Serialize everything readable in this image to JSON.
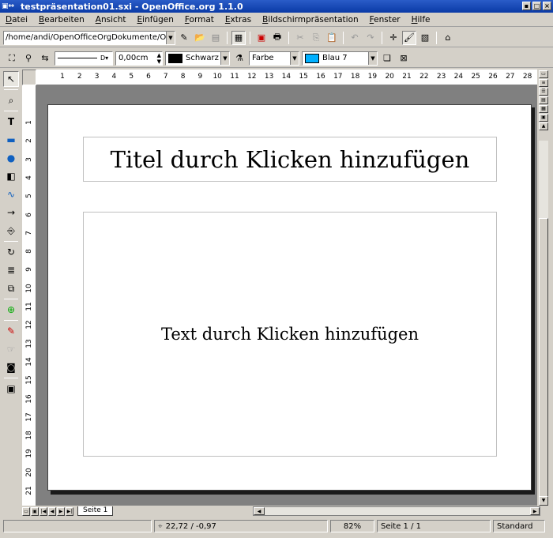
{
  "window": {
    "title": "testpräsentation01.sxi - OpenOffice.org 1.1.0"
  },
  "menu": [
    "Datei",
    "Bearbeiten",
    "Ansicht",
    "Einfügen",
    "Format",
    "Extras",
    "Bildschirmpräsentation",
    "Fenster",
    "Hilfe"
  ],
  "toolbar1": {
    "url": "/home/andi/OpenOfficeOrgDokumente/Opera"
  },
  "toolbar2": {
    "line_width": "0,00cm",
    "line_color": "Schwarz",
    "line_color_hex": "#000000",
    "area_style": "Farbe",
    "area_color": "Blau 7",
    "area_color_hex": "#00b0ff"
  },
  "hruler_ticks": [
    "1",
    "2",
    "3",
    "4",
    "5",
    "6",
    "7",
    "8",
    "9",
    "10",
    "11",
    "12",
    "13",
    "14",
    "15",
    "16",
    "17",
    "18",
    "19",
    "20",
    "21",
    "22",
    "23",
    "24",
    "25",
    "26",
    "27",
    "28"
  ],
  "vruler_ticks": [
    "1",
    "2",
    "3",
    "4",
    "5",
    "6",
    "7",
    "8",
    "9",
    "10",
    "11",
    "12",
    "13",
    "14",
    "15",
    "16",
    "17",
    "18",
    "19",
    "20",
    "21"
  ],
  "slide": {
    "title_placeholder": "Titel durch Klicken hinzufügen",
    "text_placeholder": "Text durch Klicken hinzufügen"
  },
  "tabs": {
    "slide_tab": "Seite 1"
  },
  "status": {
    "position": "22,72 / -0,97",
    "zoom": "82%",
    "page": "Seite 1 / 1",
    "layout": "Standard"
  }
}
